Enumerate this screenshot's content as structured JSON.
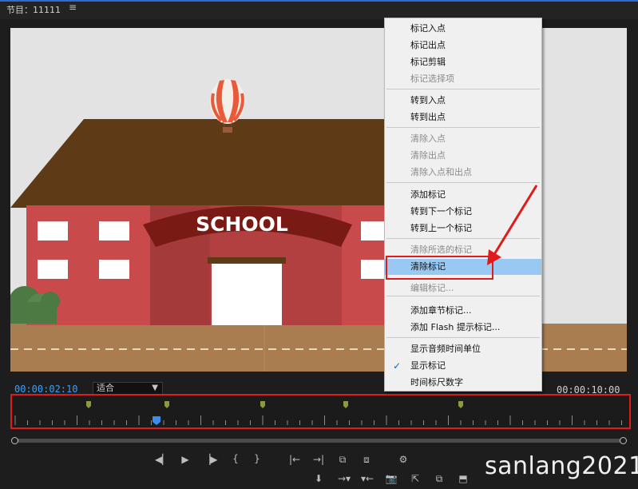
{
  "panel": {
    "title": "节目：11111",
    "menu_icon": "hamburger-icon"
  },
  "canvas": {
    "sign_text": "SCHOOL"
  },
  "playback": {
    "current_timecode": "00:00:02:10",
    "fit_value": "适合",
    "duration_timecode": "00:00:10:00"
  },
  "ruler": {
    "marker_color": "#8a9a3c",
    "playhead_color": "#3a8ef0",
    "marker_count": 5
  },
  "watermark": "sanlang2021",
  "context_menu": {
    "items": [
      {
        "label": "标记入点",
        "enabled": true
      },
      {
        "label": "标记出点",
        "enabled": true
      },
      {
        "label": "标记剪辑",
        "enabled": true
      },
      {
        "label": "标记选择项",
        "enabled": false
      },
      {
        "label": "转到入点",
        "enabled": true
      },
      {
        "label": "转到出点",
        "enabled": true
      },
      {
        "label": "清除入点",
        "enabled": false
      },
      {
        "label": "清除出点",
        "enabled": false
      },
      {
        "label": "清除入点和出点",
        "enabled": false
      },
      {
        "label": "添加标记",
        "enabled": true
      },
      {
        "label": "转到下一个标记",
        "enabled": true
      },
      {
        "label": "转到上一个标记",
        "enabled": true
      },
      {
        "label": "清除所选的标记",
        "enabled": false
      },
      {
        "label": "清除标记",
        "enabled": true,
        "highlighted": true
      },
      {
        "label": "编辑标记...",
        "enabled": false
      },
      {
        "label": "添加章节标记...",
        "enabled": true
      },
      {
        "label": "添加 Flash 提示标记...",
        "enabled": true
      },
      {
        "label": "显示音频时间单位",
        "enabled": true
      },
      {
        "label": "显示标记",
        "enabled": true,
        "checked": true
      },
      {
        "label": "时间标尺数字",
        "enabled": true
      }
    ],
    "highlight_color": "#99c9f3"
  },
  "annotation_color": "#e01b1b"
}
